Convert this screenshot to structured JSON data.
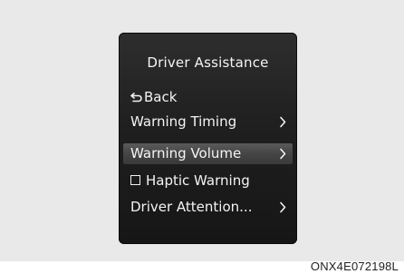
{
  "menu": {
    "title": "Driver Assistance",
    "items": [
      {
        "label": "Back",
        "icon": "back-arrow-icon",
        "selected": false
      },
      {
        "label": "Warning Timing",
        "icon": "chevron-right-icon",
        "selected": false
      },
      {
        "label": "Warning Volume",
        "icon": "chevron-right-icon",
        "selected": true
      },
      {
        "label": "Haptic Warning",
        "icon": "checkbox-icon",
        "checked": false,
        "selected": false
      },
      {
        "label": "Driver Attention...",
        "icon": "chevron-right-icon",
        "selected": false
      }
    ]
  },
  "figure_code": "ONX4E072198L",
  "colors": {
    "background": "#e9e9e9",
    "panel": "#1f1f1f",
    "selected_row": "#4a4a4a",
    "text": "#f4f4f4"
  }
}
